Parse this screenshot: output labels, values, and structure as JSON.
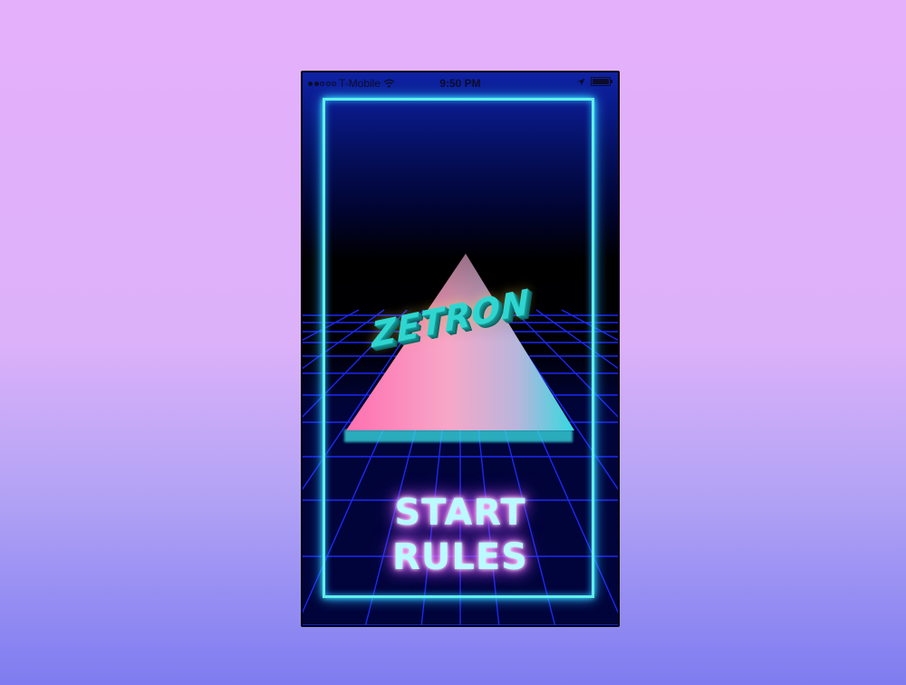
{
  "status_bar": {
    "carrier": "T-Mobile",
    "time": "9:50 PM",
    "signal_bars_filled": 2,
    "signal_bars_total": 5,
    "icons": [
      "signal-dots-icon",
      "wifi-icon",
      "location-arrow-icon",
      "battery-icon"
    ]
  },
  "game": {
    "logo": "ZETRON",
    "start_label": "START",
    "rules_label": "RULES"
  },
  "colors": {
    "neon_frame": "#5ff0e6",
    "triangle_pink": "#ff7fb8",
    "triangle_cyan": "#35d6df",
    "grid_line": "#1c2bff",
    "logo": "#2fd6d0",
    "button_text": "#b9fbff",
    "button_glow": "#e45cff"
  }
}
